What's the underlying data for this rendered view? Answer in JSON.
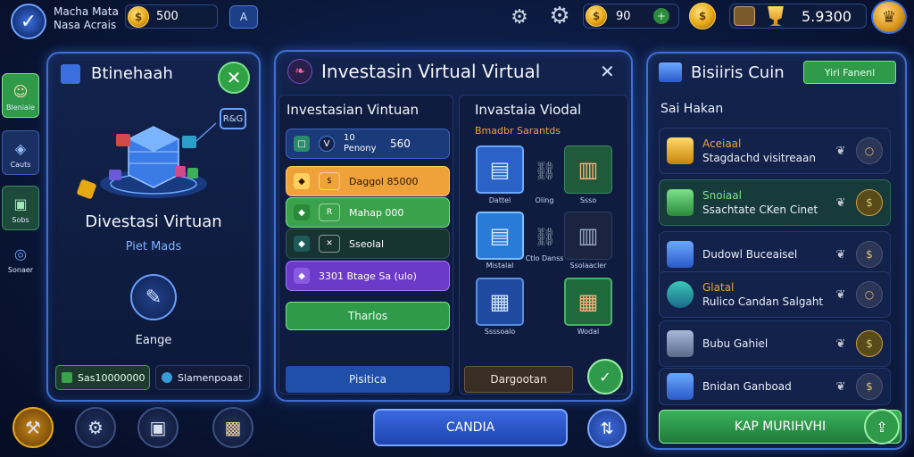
{
  "topbar": {
    "player_name_line1": "Macha Mata",
    "player_name_line2": "Nasa Acrais",
    "coins": "500",
    "square_button": "A",
    "resource_value": "90",
    "resource_plus": "+",
    "gold_value": "5.9300"
  },
  "left_rail": {
    "items": [
      {
        "label": "Bleniaie",
        "icon": "avatar-icon"
      },
      {
        "label": "Cauts",
        "icon": "stack-icon"
      },
      {
        "label": "Sobs",
        "icon": "box-icon"
      },
      {
        "label": "Sonaer",
        "icon": "target-icon"
      }
    ]
  },
  "left_panel": {
    "title": "Btinehaah",
    "close_label": "✕",
    "tag_label": "R&G",
    "big_title": "Divestasi Virtuan",
    "sub_title": "Piet Mads",
    "wrench_label": "Eange",
    "chip_left": "Sas10000000",
    "chip_right": "Slamenpoaat"
  },
  "mid_panel": {
    "title": "Investasin Virtual Virtual",
    "close_label": "✕",
    "list_title": "Investasian Vintuan",
    "rows": [
      {
        "line1": "10",
        "line2": "Penony",
        "value": "560",
        "color": "#1b3a7a"
      },
      {
        "text": "Daggol 85000",
        "color": "#f0a23a"
      },
      {
        "text": "Mahap 000",
        "color": "#3aa24a"
      },
      {
        "text": "Sseolal",
        "color": "#183432"
      },
      {
        "text": "3301 Btage Sa (ulo)",
        "color": "#6c3ac9"
      }
    ],
    "green_button": "Tharlos",
    "blue_button": "Pisitica",
    "grid_title": "Invastaia Viodal",
    "grid_subtitle": "Bmadbr Sarantds",
    "tiles": [
      {
        "label": "Dattel",
        "icon": "server-icon"
      },
      {
        "label": "Oling",
        "icon": "link-icon"
      },
      {
        "label": "Ssso",
        "icon": "building-icon"
      },
      {
        "label": "Mistalal",
        "icon": "server-icon"
      },
      {
        "label": "Ctlo Danss",
        "icon": "link-icon"
      },
      {
        "label": "Ssolaacler",
        "icon": "building-icon"
      },
      {
        "label": "Ssssoalo",
        "icon": "crate-icon"
      },
      {
        "label": "Wodal",
        "icon": "crate-icon"
      }
    ],
    "dark_button": "Dargootan",
    "shield_label": "✓"
  },
  "right_panel": {
    "title": "Bisiiris Cuin",
    "header_button": "Yiri Fanenl",
    "section_label": "Sai Hakan",
    "rows": [
      {
        "line1": "Aceiaal",
        "line2": "Stagdachd visitreaan"
      },
      {
        "line1": "Snoiaal",
        "line2": "Ssachtate CKen Cinet"
      },
      {
        "line1": "Dudowl Buceaisel",
        "line2": ""
      },
      {
        "line1": "Glatal",
        "line2": "Rulico Candan Salgaht"
      },
      {
        "line1": "Bubu Gahiel",
        "line2": ""
      },
      {
        "line1": "Bnidan Ganboad",
        "line2": ""
      }
    ],
    "big_button": "KAP MURIHVHI"
  },
  "bottom": {
    "cancel_button": "CANDIA"
  },
  "colors": {
    "panel_border": "#3e6fd1",
    "accent_green": "#3aa24a",
    "accent_gold": "#e7a813",
    "background": "#0b1a3f"
  }
}
